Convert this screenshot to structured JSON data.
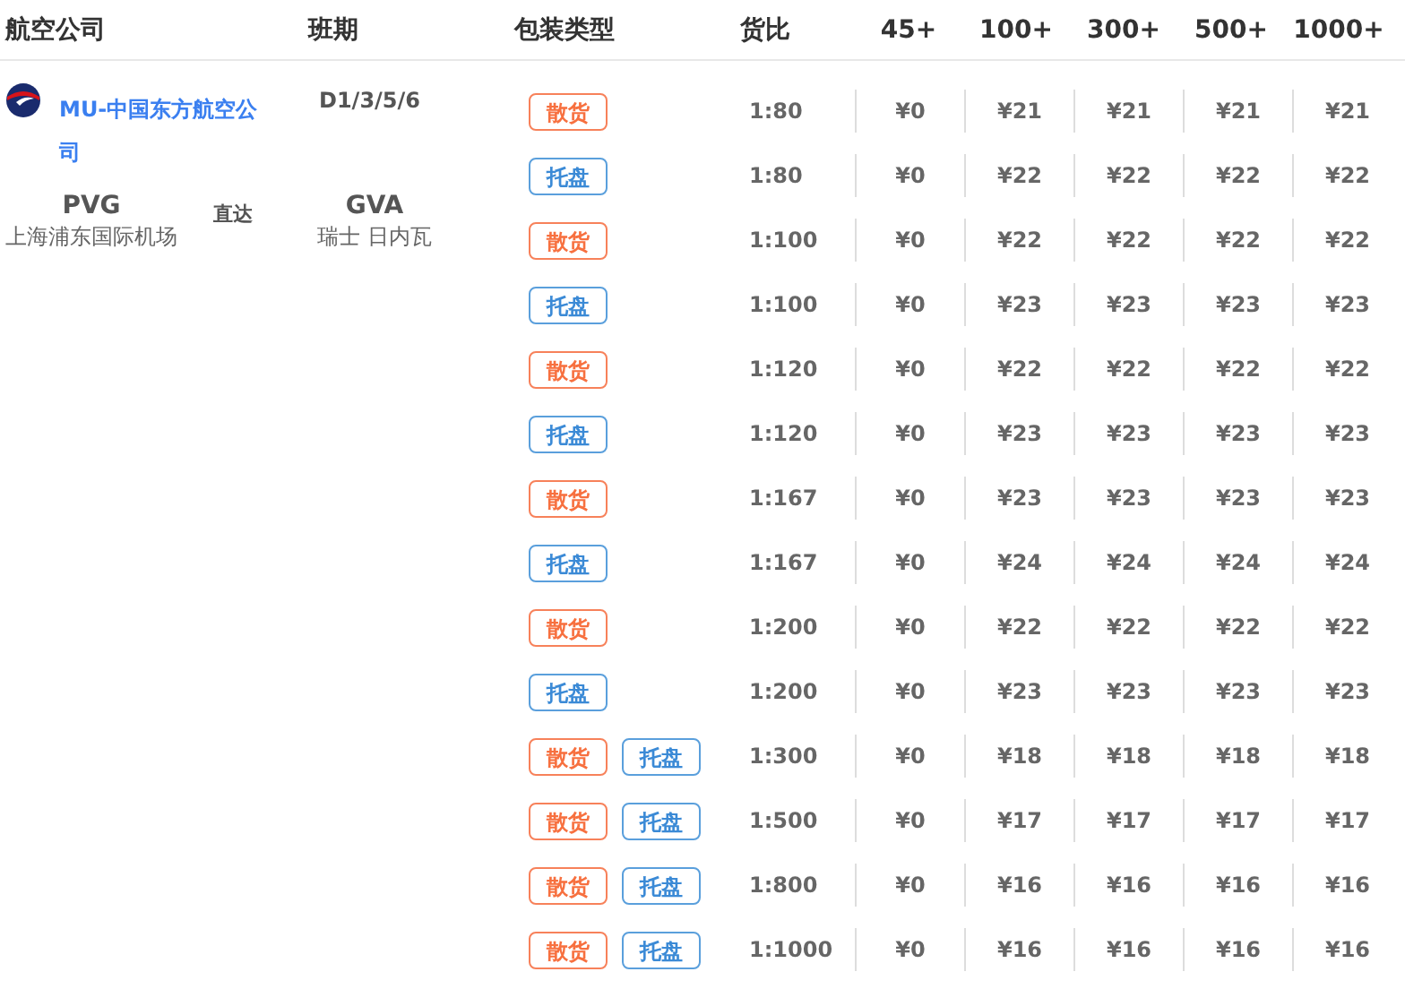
{
  "columns": [
    "航空公司",
    "班期",
    "包装类型",
    "货比",
    "45+",
    "100+",
    "300+",
    "500+",
    "1000+"
  ],
  "airline": {
    "name": "MU-中国东方航空公司",
    "schedule": "D1/3/5/6",
    "origin_code": "PVG",
    "origin_name": "上海浦东国际机场",
    "route_type": "直达",
    "dest_code": "GVA",
    "dest_name": "瑞士 日内瓦"
  },
  "rows": [
    {
      "packages": [
        {
          "kind": "bulk",
          "label": "散货"
        }
      ],
      "ratio": "1:80",
      "prices": [
        "¥0",
        "¥21",
        "¥21",
        "¥21",
        "¥21"
      ]
    },
    {
      "packages": [
        {
          "kind": "pallet",
          "label": "托盘"
        }
      ],
      "ratio": "1:80",
      "prices": [
        "¥0",
        "¥22",
        "¥22",
        "¥22",
        "¥22"
      ]
    },
    {
      "packages": [
        {
          "kind": "bulk",
          "label": "散货"
        }
      ],
      "ratio": "1:100",
      "prices": [
        "¥0",
        "¥22",
        "¥22",
        "¥22",
        "¥22"
      ]
    },
    {
      "packages": [
        {
          "kind": "pallet",
          "label": "托盘"
        }
      ],
      "ratio": "1:100",
      "prices": [
        "¥0",
        "¥23",
        "¥23",
        "¥23",
        "¥23"
      ]
    },
    {
      "packages": [
        {
          "kind": "bulk",
          "label": "散货"
        }
      ],
      "ratio": "1:120",
      "prices": [
        "¥0",
        "¥22",
        "¥22",
        "¥22",
        "¥22"
      ]
    },
    {
      "packages": [
        {
          "kind": "pallet",
          "label": "托盘"
        }
      ],
      "ratio": "1:120",
      "prices": [
        "¥0",
        "¥23",
        "¥23",
        "¥23",
        "¥23"
      ]
    },
    {
      "packages": [
        {
          "kind": "bulk",
          "label": "散货"
        }
      ],
      "ratio": "1:167",
      "prices": [
        "¥0",
        "¥23",
        "¥23",
        "¥23",
        "¥23"
      ]
    },
    {
      "packages": [
        {
          "kind": "pallet",
          "label": "托盘"
        }
      ],
      "ratio": "1:167",
      "prices": [
        "¥0",
        "¥24",
        "¥24",
        "¥24",
        "¥24"
      ]
    },
    {
      "packages": [
        {
          "kind": "bulk",
          "label": "散货"
        }
      ],
      "ratio": "1:200",
      "prices": [
        "¥0",
        "¥22",
        "¥22",
        "¥22",
        "¥22"
      ]
    },
    {
      "packages": [
        {
          "kind": "pallet",
          "label": "托盘"
        }
      ],
      "ratio": "1:200",
      "prices": [
        "¥0",
        "¥23",
        "¥23",
        "¥23",
        "¥23"
      ]
    },
    {
      "packages": [
        {
          "kind": "bulk",
          "label": "散货"
        },
        {
          "kind": "pallet",
          "label": "托盘"
        }
      ],
      "ratio": "1:300",
      "prices": [
        "¥0",
        "¥18",
        "¥18",
        "¥18",
        "¥18"
      ]
    },
    {
      "packages": [
        {
          "kind": "bulk",
          "label": "散货"
        },
        {
          "kind": "pallet",
          "label": "托盘"
        }
      ],
      "ratio": "1:500",
      "prices": [
        "¥0",
        "¥17",
        "¥17",
        "¥17",
        "¥17"
      ]
    },
    {
      "packages": [
        {
          "kind": "bulk",
          "label": "散货"
        },
        {
          "kind": "pallet",
          "label": "托盘"
        }
      ],
      "ratio": "1:800",
      "prices": [
        "¥0",
        "¥16",
        "¥16",
        "¥16",
        "¥16"
      ]
    },
    {
      "packages": [
        {
          "kind": "bulk",
          "label": "散货"
        },
        {
          "kind": "pallet",
          "label": "托盘"
        }
      ],
      "ratio": "1:1000",
      "prices": [
        "¥0",
        "¥16",
        "¥16",
        "¥16",
        "¥16"
      ]
    }
  ]
}
